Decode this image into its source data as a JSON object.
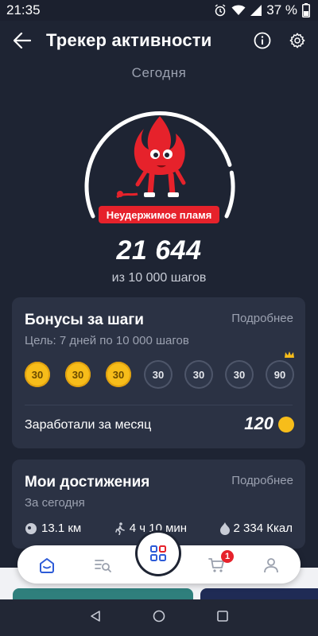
{
  "status": {
    "time": "21:35",
    "battery": "37 %"
  },
  "header": {
    "title": "Трекер активности"
  },
  "summary": {
    "period": "Сегодня",
    "badge": "Неудержимое пламя",
    "steps": "21 644",
    "goal_text": "из 10 000 шагов",
    "progress": 1.0
  },
  "bonus_card": {
    "title": "Бонусы за шаги",
    "more": "Подробнее",
    "goal": "Цель: 7 дней по 10 000 шагов",
    "coins": [
      {
        "value": "30",
        "earned": true
      },
      {
        "value": "30",
        "earned": true
      },
      {
        "value": "30",
        "earned": true
      },
      {
        "value": "30",
        "earned": false
      },
      {
        "value": "30",
        "earned": false
      },
      {
        "value": "30",
        "earned": false
      },
      {
        "value": "90",
        "earned": false,
        "crown": true
      }
    ],
    "earned_label": "Заработали за месяц",
    "earned_value": "120"
  },
  "achievements": {
    "title": "Мои достижения",
    "more": "Подробнее",
    "period": "За сегодня",
    "distance": "13.1 км",
    "duration": "4 ч 10 мин",
    "calories": "2 334 Ккал"
  },
  "bottom_nav": {
    "cart_count": "1"
  },
  "colors": {
    "accent_red": "#e6222b",
    "coin_gold": "#f7bd1a",
    "background": "#1e2433",
    "card": "#2b3244"
  }
}
